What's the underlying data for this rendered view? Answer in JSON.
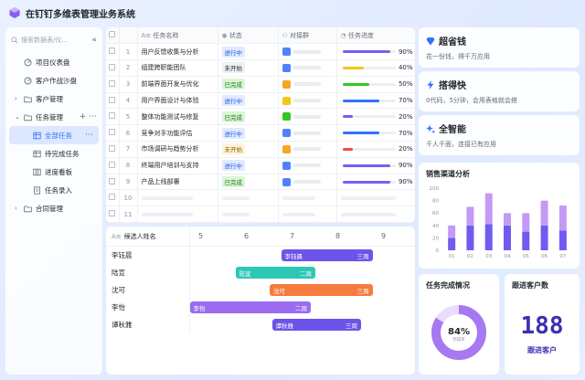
{
  "app": {
    "title": "在钉钉多维表管理业务系统"
  },
  "sidebar": {
    "search_placeholder": "搜索数据表/仪...",
    "items": [
      {
        "label": "项目仪表盘",
        "icon": "dashboard-icon"
      },
      {
        "label": "客户作战沙盘",
        "icon": "dashboard-icon"
      },
      {
        "label": "客户管理",
        "icon": "folder-icon"
      },
      {
        "label": "任务管理",
        "icon": "folder-icon"
      },
      {
        "label": "全部任务",
        "icon": "table-icon"
      },
      {
        "label": "待完成任务",
        "icon": "table-icon"
      },
      {
        "label": "进度看板",
        "icon": "kanban-icon"
      },
      {
        "label": "任务录入",
        "icon": "form-icon"
      },
      {
        "label": "合同管理",
        "icon": "folder-icon"
      }
    ]
  },
  "table": {
    "columns": [
      "任务名称",
      "状态",
      "对接群",
      "任务进度"
    ],
    "rows": [
      {
        "n": "1",
        "name": "用户反馈收集与分析",
        "status": "进行中",
        "st": "doing",
        "pct": 90,
        "pct_label": "90%",
        "color": "#7b5cf5",
        "av": "#4e83fd"
      },
      {
        "n": "2",
        "name": "组建跨职能团队",
        "status": "未开始",
        "st": "todo",
        "pct": 40,
        "pct_label": "40%",
        "color": "#f5c518",
        "av": "#4e83fd"
      },
      {
        "n": "3",
        "name": "前端界面开发与优化",
        "status": "已完成",
        "st": "done",
        "pct": 50,
        "pct_label": "50%",
        "color": "#34c724",
        "av": "#f5a623"
      },
      {
        "n": "4",
        "name": "用户界面设计与体验",
        "status": "进行中",
        "st": "doing",
        "pct": 70,
        "pct_label": "70%",
        "color": "#3370ff",
        "av": "#f5c518"
      },
      {
        "n": "5",
        "name": "整体功能测试与修复",
        "status": "已完成",
        "st": "done",
        "pct": 20,
        "pct_label": "20%",
        "color": "#7b5cf5",
        "av": "#34c724"
      },
      {
        "n": "6",
        "name": "竞争对手功能评估",
        "status": "进行中",
        "st": "doing",
        "pct": 70,
        "pct_label": "70%",
        "color": "#3370ff",
        "av": "#4e83fd"
      },
      {
        "n": "7",
        "name": "市场调研与趋势分析",
        "status": "未开始",
        "st": "delay",
        "pct": 20,
        "pct_label": "20%",
        "color": "#f54a45",
        "av": "#f5a623"
      },
      {
        "n": "8",
        "name": "终端用户培训与支持",
        "status": "进行中",
        "st": "doing",
        "pct": 90,
        "pct_label": "90%",
        "color": "#7b5cf5",
        "av": "#4e83fd"
      },
      {
        "n": "9",
        "name": "产品上线部署",
        "status": "已完成",
        "st": "done",
        "pct": 90,
        "pct_label": "90%",
        "color": "#7b5cf5",
        "av": "#4e83fd"
      }
    ],
    "empty_rows": [
      "10",
      "11"
    ]
  },
  "gantt": {
    "header": "候选人姓名",
    "days": [
      "5",
      "6",
      "7",
      "8",
      "9"
    ],
    "rows": [
      {
        "name": "李钰晨",
        "label": "李钰晨",
        "tag": "三周",
        "start": 6.75,
        "end": 8.75,
        "color": "#6d54e8"
      },
      {
        "name": "陆宣",
        "label": "陆宣",
        "tag": "二周",
        "start": 5.75,
        "end": 7.5,
        "color": "#2dc8b4"
      },
      {
        "name": "沈可",
        "label": "沈可",
        "tag": "三周",
        "start": 6.5,
        "end": 8.75,
        "color": "#f57c3c"
      },
      {
        "name": "李怡",
        "label": "李怡",
        "tag": "二周",
        "start": 4.75,
        "end": 7.4,
        "color": "#9b6cf0"
      },
      {
        "name": "谭秋雅",
        "label": "谭秋雅",
        "tag": "三周",
        "start": 6.55,
        "end": 8.5,
        "color": "#6d54e8"
      }
    ]
  },
  "features": [
    {
      "title": "超省钱",
      "desc": "花一份钱，得千万应用",
      "icon": "diamond-icon"
    },
    {
      "title": "搭得快",
      "desc": "0代码，5分钟，会用表格就会搭",
      "icon": "lightning-icon"
    },
    {
      "title": "全智能",
      "desc": "千人千面，连接已有应用",
      "icon": "sparkle-icon"
    }
  ],
  "chart_data": [
    {
      "type": "bar",
      "title": "销售渠道分析",
      "categories": [
        "01",
        "02",
        "03",
        "04",
        "05",
        "06",
        "07"
      ],
      "ylim": [
        0,
        100
      ],
      "yticks": [
        "100",
        "80",
        "60",
        "40",
        "20",
        "0"
      ],
      "series": [
        {
          "values": [
            20,
            40,
            42,
            40,
            30,
            40,
            32
          ]
        },
        {
          "values": [
            20,
            30,
            50,
            20,
            30,
            40,
            40
          ]
        }
      ]
    },
    {
      "type": "pie",
      "title": "任务完成情况",
      "values": [
        84,
        16
      ],
      "center_label": "84%",
      "center_sub": "完成率"
    }
  ],
  "customers": {
    "title": "跟进客户数",
    "value": "188",
    "sub": "跟进客户"
  }
}
